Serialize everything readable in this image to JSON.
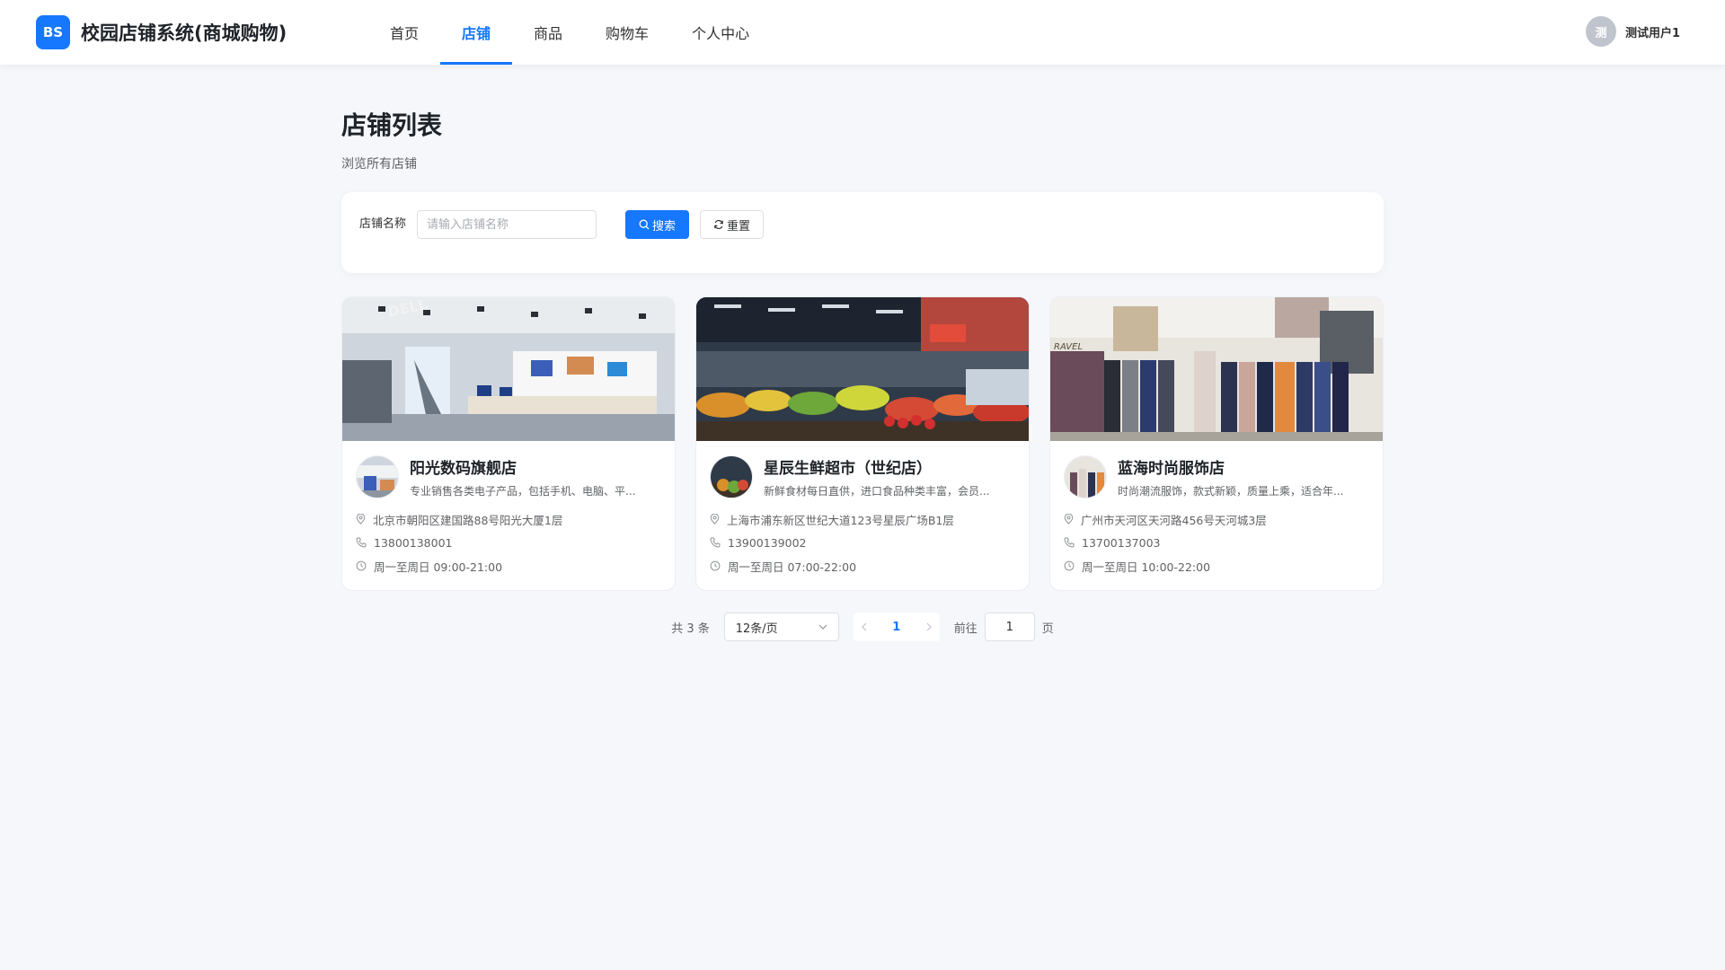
{
  "header": {
    "logo_badge": "BS",
    "title": "校园店铺系统(商城购物)",
    "nav": [
      {
        "label": "首页",
        "active": false
      },
      {
        "label": "店铺",
        "active": true
      },
      {
        "label": "商品",
        "active": false
      },
      {
        "label": "购物车",
        "active": false
      },
      {
        "label": "个人中心",
        "active": false
      }
    ],
    "user": {
      "avatar_text": "测",
      "name": "测试用户1"
    }
  },
  "page": {
    "title": "店铺列表",
    "subtitle": "浏览所有店铺"
  },
  "search": {
    "label": "店铺名称",
    "placeholder": "请输入店铺名称",
    "value": "",
    "search_button": "搜索",
    "reset_button": "重置"
  },
  "shops": [
    {
      "name": "阳光数码旗舰店",
      "description": "专业销售各类电子产品，包括手机、电脑、平...",
      "address": "北京市朝阳区建国路88号阳光大厦1层",
      "phone": "13800138001",
      "hours": "周一至周日 09:00-21:00",
      "image": "electronics-store-photo"
    },
    {
      "name": "星辰生鲜超市（世纪店）",
      "description": "新鲜食材每日直供，进口食品种类丰富，会员...",
      "address": "上海市浦东新区世纪大道123号星辰广场B1层",
      "phone": "13900139002",
      "hours": "周一至周日 07:00-22:00",
      "image": "fresh-market-photo"
    },
    {
      "name": "蓝海时尚服饰店",
      "description": "时尚潮流服饰，款式新颖，质量上乘，适合年...",
      "address": "广州市天河区天河路456号天河城3层",
      "phone": "13700137003",
      "hours": "周一至周日 10:00-22:00",
      "image": "clothing-store-photo"
    }
  ],
  "pagination": {
    "total_text": "共 3 条",
    "page_size": "12条/页",
    "current_page": "1",
    "goto_label": "前往",
    "goto_value": "1",
    "page_unit": "页"
  },
  "colors": {
    "primary": "#1677ff",
    "background": "#f5f7fa"
  }
}
